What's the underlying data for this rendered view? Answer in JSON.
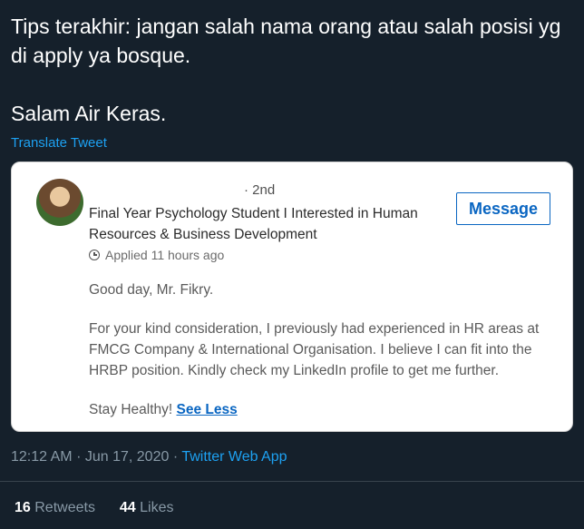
{
  "tweet": {
    "text": "Tips terakhir: jangan salah nama orang atau salah posisi yg di apply ya bosque.\n\nSalam Air Keras.",
    "translate_label": "Translate Tweet"
  },
  "card": {
    "degree": "· 2nd",
    "headline": "Final Year Psychology Student I Interested in Human Resources & Business Development",
    "message_button": "Message",
    "applied": "Applied 11 hours ago",
    "greeting": "Good day, Mr. Fikry.",
    "body": "For your kind consideration, I previously had experienced in HR areas at FMCG Company & International Organisation. I believe I can fit into the HRBP position. Kindly check my LinkedIn profile to get me further.",
    "closing": "Stay Healthy!",
    "see_less": "See Less",
    "icons": {
      "applied": "clock-icon"
    }
  },
  "meta": {
    "time": "12:12 AM",
    "separator": "·",
    "date": "Jun 17, 2020",
    "app": "Twitter Web App"
  },
  "stats": {
    "retweets_count": "16",
    "retweets_label": "Retweets",
    "likes_count": "44",
    "likes_label": "Likes"
  },
  "colors": {
    "background": "#15202b",
    "accent": "#1da1f2",
    "linkedin_blue": "#0a66c2"
  }
}
